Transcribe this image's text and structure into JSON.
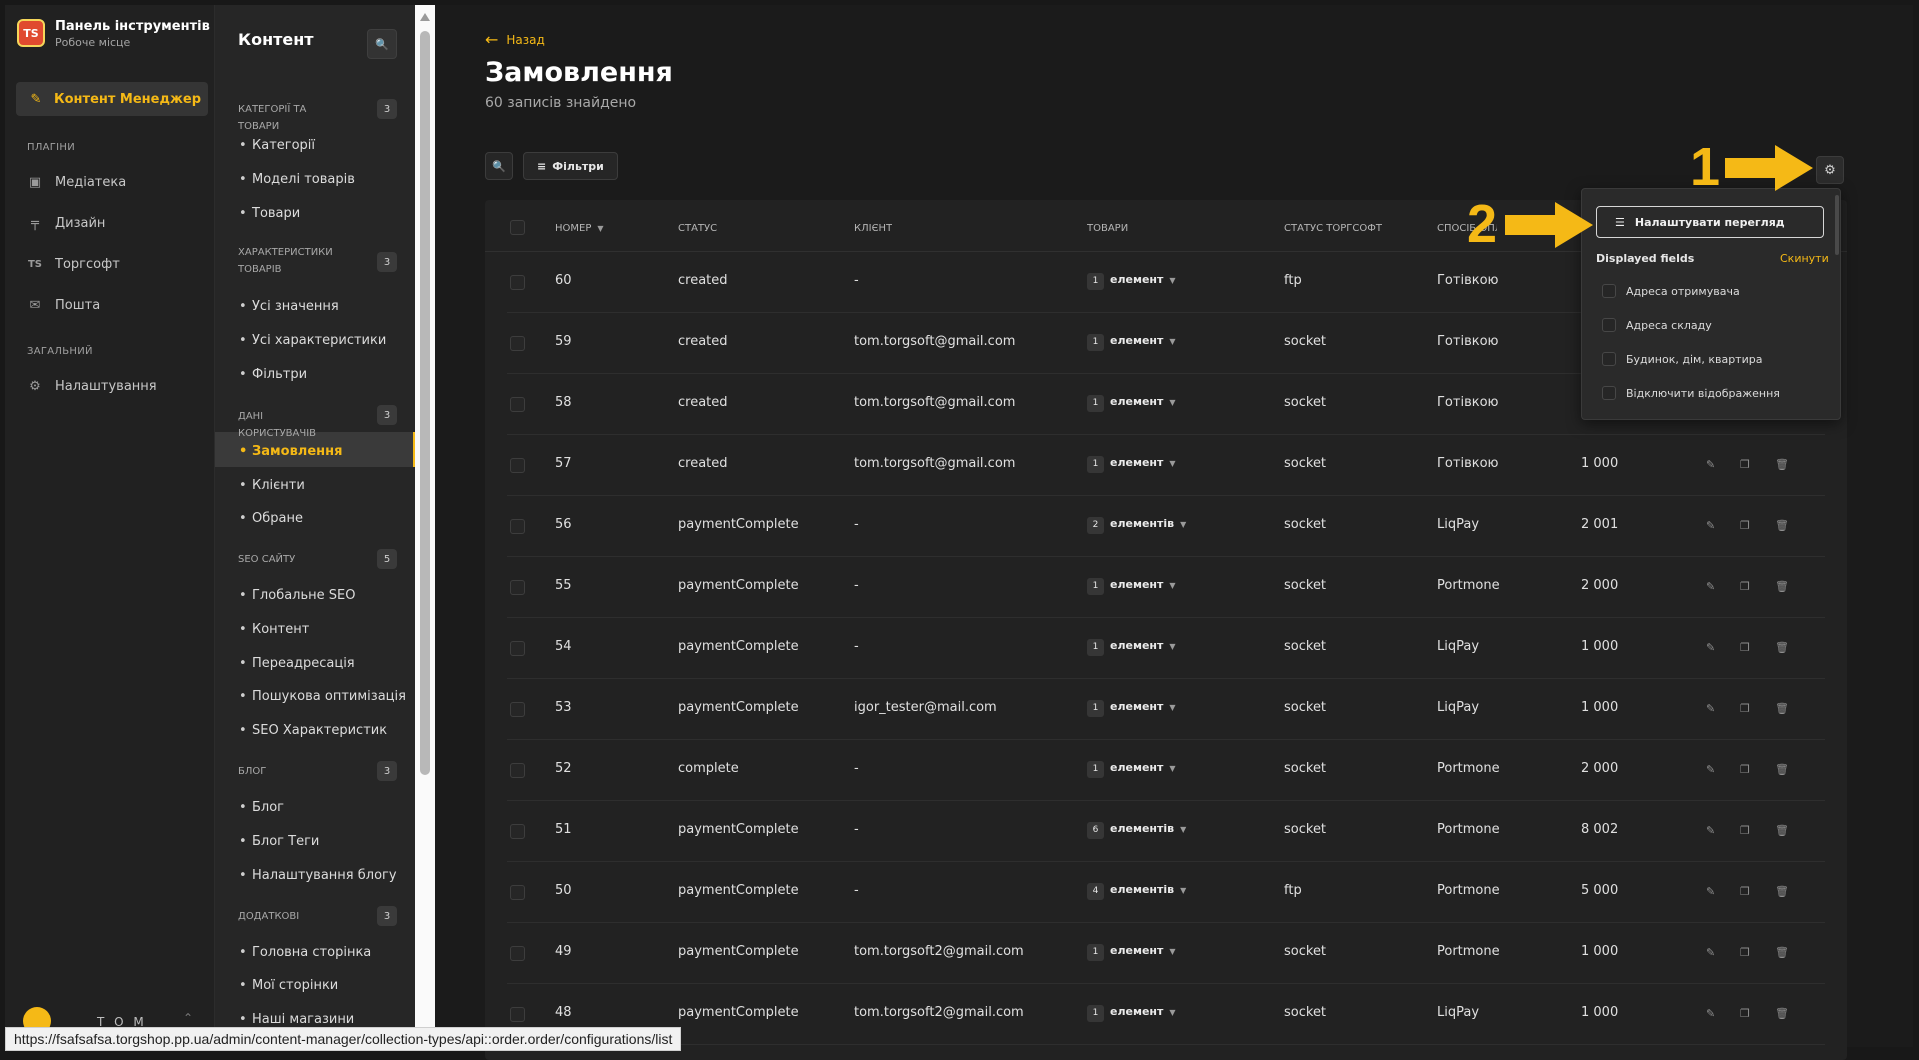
{
  "brand": {
    "logo": "TS",
    "title": "Панель інструментів",
    "subtitle": "Робоче місце"
  },
  "nav": {
    "active": {
      "label": "Контент Менеджер",
      "icon": "pencil-icon"
    },
    "section_plugins": "ПЛАГІНИ",
    "plugins": [
      {
        "label": "Медіатека",
        "icon": "image-icon"
      },
      {
        "label": "Дизайн",
        "icon": "paint-roller-icon"
      },
      {
        "label": "Торгсофт",
        "icon": "ts-icon"
      },
      {
        "label": "Пошта",
        "icon": "mail-icon"
      }
    ],
    "section_general": "ЗАГАЛЬНИЙ",
    "general": [
      {
        "label": "Налаштування",
        "icon": "gear-icon"
      }
    ],
    "user_name": "T O M"
  },
  "subnav": {
    "title": "Контент",
    "groups": [
      {
        "label": "КАТЕГОРІЇ ТА ТОВАРИ",
        "count": "3",
        "items": [
          "Категорії",
          "Моделі товарів",
          "Товари"
        ]
      },
      {
        "label": "ХАРАКТЕРИСТИКИ ТОВАРІВ",
        "count": "3",
        "items": [
          "Усі значення",
          "Усі характеристики",
          "Фільтри"
        ]
      },
      {
        "label": "ДАНІ КОРИСТУВАЧІВ",
        "count": "3",
        "items": [
          "Замовлення",
          "Клієнти",
          "Обране"
        ]
      },
      {
        "label": "SEO САЙТУ",
        "count": "5",
        "items": [
          "Глобальне SEO",
          "Контент",
          "Переадресація",
          "Пошукова оптимізація",
          "SEO Характеристик"
        ]
      },
      {
        "label": "БЛОГ",
        "count": "3",
        "items": [
          "Блог",
          "Блог Теги",
          "Налаштування блогу"
        ]
      },
      {
        "label": "ДОДАТКОВІ",
        "count": "3",
        "items": [
          "Головна сторінка",
          "Мої сторінки",
          "Наші магазини"
        ]
      }
    ]
  },
  "main": {
    "back": "Назад",
    "title": "Замовлення",
    "subtitle": "60 записів знайдено",
    "filters": "Фільтри"
  },
  "table": {
    "headers": [
      "НОМЕР",
      "СТАТУС",
      "КЛІЄНТ",
      "ТОВАРИ",
      "СТАТУС ТОРГСОФТ",
      "СПОСІБ ОПЛАТИ"
    ],
    "rows": [
      {
        "id": "60",
        "status": "created",
        "client": "-",
        "qty": "1",
        "items": "елемент",
        "ts": "ftp",
        "pay": "Готівкою",
        "sum": ""
      },
      {
        "id": "59",
        "status": "created",
        "client": "tom.torgsoft@gmail.com",
        "qty": "1",
        "items": "елемент",
        "ts": "socket",
        "pay": "Готівкою",
        "sum": ""
      },
      {
        "id": "58",
        "status": "created",
        "client": "tom.torgsoft@gmail.com",
        "qty": "1",
        "items": "елемент",
        "ts": "socket",
        "pay": "Готівкою",
        "sum": ""
      },
      {
        "id": "57",
        "status": "created",
        "client": "tom.torgsoft@gmail.com",
        "qty": "1",
        "items": "елемент",
        "ts": "socket",
        "pay": "Готівкою",
        "sum": "1 000"
      },
      {
        "id": "56",
        "status": "paymentComplete",
        "client": "-",
        "qty": "2",
        "items": "елементів",
        "ts": "socket",
        "pay": "LiqPay",
        "sum": "2 001"
      },
      {
        "id": "55",
        "status": "paymentComplete",
        "client": "-",
        "qty": "1",
        "items": "елемент",
        "ts": "socket",
        "pay": "Portmone",
        "sum": "2 000"
      },
      {
        "id": "54",
        "status": "paymentComplete",
        "client": "-",
        "qty": "1",
        "items": "елемент",
        "ts": "socket",
        "pay": "LiqPay",
        "sum": "1 000"
      },
      {
        "id": "53",
        "status": "paymentComplete",
        "client": "igor_tester@mail.com",
        "qty": "1",
        "items": "елемент",
        "ts": "socket",
        "pay": "LiqPay",
        "sum": "1 000"
      },
      {
        "id": "52",
        "status": "complete",
        "client": "-",
        "qty": "1",
        "items": "елемент",
        "ts": "socket",
        "pay": "Portmone",
        "sum": "2 000"
      },
      {
        "id": "51",
        "status": "paymentComplete",
        "client": "-",
        "qty": "6",
        "items": "елементів",
        "ts": "socket",
        "pay": "Portmone",
        "sum": "8 002"
      },
      {
        "id": "50",
        "status": "paymentComplete",
        "client": "-",
        "qty": "4",
        "items": "елементів",
        "ts": "ftp",
        "pay": "Portmone",
        "sum": "5 000"
      },
      {
        "id": "49",
        "status": "paymentComplete",
        "client": "tom.torgsoft2@gmail.com",
        "qty": "1",
        "items": "елемент",
        "ts": "socket",
        "pay": "Portmone",
        "sum": "1 000"
      },
      {
        "id": "48",
        "status": "paymentComplete",
        "client": "tom.torgsoft2@gmail.com",
        "qty": "1",
        "items": "елемент",
        "ts": "socket",
        "pay": "LiqPay",
        "sum": "1 000"
      }
    ]
  },
  "popover": {
    "configure": "Налаштувати перегляд",
    "displayed_fields": "Displayed fields",
    "reset": "Скинути",
    "options": [
      "Адреса отримувача",
      "Адреса складу",
      "Будинок, дім, квартира",
      "Відключити відображення"
    ]
  },
  "annotations": {
    "one": "1",
    "two": "2",
    "color": "#f5b916"
  },
  "status_url": "https://fsafsafsa.torgshop.pp.ua/admin/content-manager/collection-types/api::order.order/configurations/list",
  "colors": {
    "accent": "#f5b916",
    "background": "#1b1b1b"
  }
}
